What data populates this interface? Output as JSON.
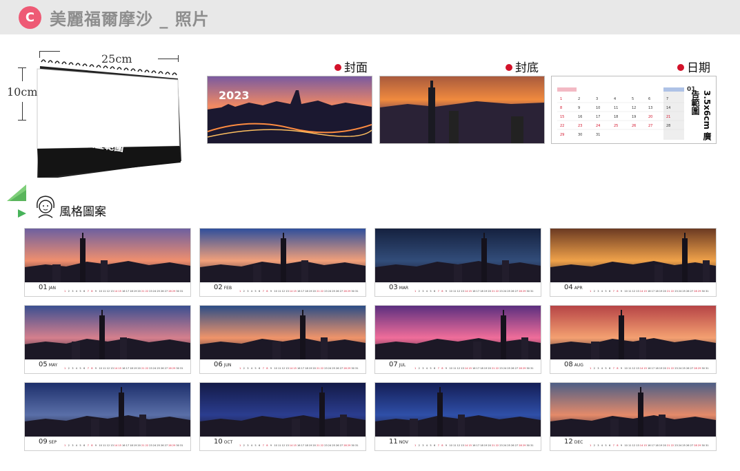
{
  "header": {
    "badge": "C",
    "title": "美麗福爾摩沙 _ 照片"
  },
  "mock": {
    "width_label": "25cm",
    "height_label": "10cm",
    "base_label": "桌檯燙金範圍"
  },
  "sections": {
    "cover": "封面",
    "back": "封底",
    "date": "日期"
  },
  "cover_year": "2023",
  "date_panel": {
    "day_label": "01",
    "ad_text": "3.5x6cm 廣告範圍"
  },
  "style": {
    "title": "風格圖案"
  },
  "months": [
    {
      "num": "01",
      "abbr": "JAN",
      "sky": [
        "#6d5fa0",
        "#f08f6e"
      ]
    },
    {
      "num": "02",
      "abbr": "FEB",
      "sky": [
        "#2f4f9c",
        "#f2a07a"
      ]
    },
    {
      "num": "03",
      "abbr": "MAR",
      "sky": [
        "#15213f",
        "#324d7a"
      ]
    },
    {
      "num": "04",
      "abbr": "APR",
      "sky": [
        "#6b3a22",
        "#f0a24a"
      ]
    },
    {
      "num": "05",
      "abbr": "MAY",
      "sky": [
        "#3b4f91",
        "#d57f8d"
      ]
    },
    {
      "num": "06",
      "abbr": "JUN",
      "sky": [
        "#2c4d86",
        "#f0946a"
      ]
    },
    {
      "num": "07",
      "abbr": "JUL",
      "sky": [
        "#5b2f7f",
        "#f06d9a"
      ]
    },
    {
      "num": "08",
      "abbr": "AUG",
      "sky": [
        "#b64446",
        "#f4a071"
      ]
    },
    {
      "num": "09",
      "abbr": "SEP",
      "sky": [
        "#1d2f6b",
        "#5a6fa8"
      ]
    },
    {
      "num": "10",
      "abbr": "OCT",
      "sky": [
        "#131a47",
        "#2b3d8f"
      ]
    },
    {
      "num": "11",
      "abbr": "NOV",
      "sky": [
        "#141e56",
        "#2f4fa8"
      ]
    },
    {
      "num": "12",
      "abbr": "DEC",
      "sky": [
        "#4d5e86",
        "#e48a6a"
      ]
    }
  ],
  "colors": {
    "red_dot": "#d3122a",
    "badge": "#ee5a75",
    "header_bg": "#e8e8e8",
    "header_text": "#8d8d8d"
  },
  "icons": [
    "triangle-icon",
    "girl-face-icon"
  ]
}
